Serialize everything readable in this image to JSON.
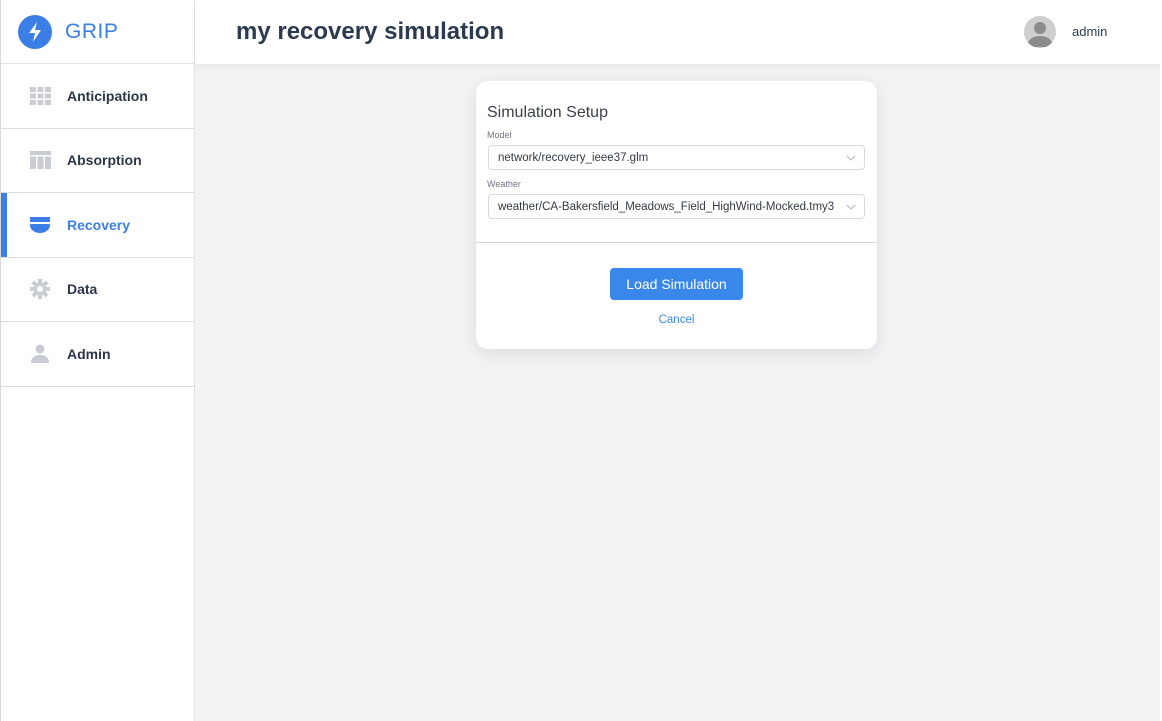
{
  "app": {
    "name": "GRIP",
    "accent": "#3a7ee6"
  },
  "header": {
    "title": "my recovery simulation",
    "user": "admin"
  },
  "sidebar": {
    "items": [
      {
        "label": "Anticipation",
        "icon": "grid-icon",
        "active": false
      },
      {
        "label": "Absorption",
        "icon": "table-icon",
        "active": false
      },
      {
        "label": "Recovery",
        "icon": "recovery-icon",
        "active": true
      },
      {
        "label": "Data",
        "icon": "gear-icon",
        "active": false
      },
      {
        "label": "Admin",
        "icon": "user-icon",
        "active": false
      }
    ]
  },
  "modal": {
    "title": "Simulation Setup",
    "model_label": "Model",
    "model_value": "network/recovery_ieee37.glm",
    "weather_label": "Weather",
    "weather_value": "weather/CA-Bakersfield_Meadows_Field_HighWind-Mocked.tmy3",
    "load_label": "Load Simulation",
    "cancel_label": "Cancel"
  }
}
